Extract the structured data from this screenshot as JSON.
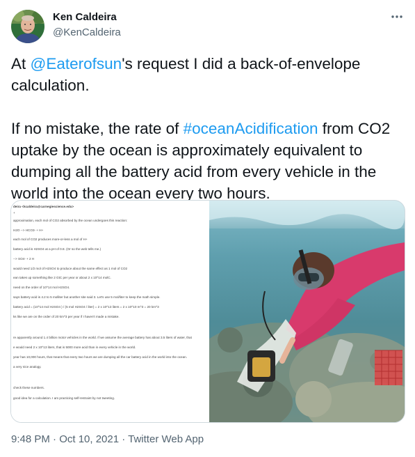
{
  "author": {
    "name": "Ken Caldeira",
    "handle": "@KenCaldeira"
  },
  "more_icon": "more-horizontal-icon",
  "tweet": {
    "p1_before": "At ",
    "p1_mention": "@Eaterofsun",
    "p1_after": "'s request I did a back-of-envelope calculation.",
    "p2_before": "If no mistake, the rate of ",
    "p2_hashtag": "#oceanAcidification",
    "p2_after": " from CO2 uptake by the ocean is approximately equivalent to dumping all the battery acid from every vehicle in the world into the ocean every two hours."
  },
  "media": {
    "document_lines": [
      "deira <kcaldeira@carnegiescience.edu>",
      "+",
      "approximation, each mol of CO2 absorbed by the ocean undergoes this reaction:",
      "H2O --> HCO3- + H+",
      "each mol of CO2 produces more-or-less a mol of H+",
      "battery acid is H2SO4 at a pH of 0.8. (Or so the web tells me.)",
      "--> SO4- + 2 H",
      "would need 1/2 mol of H2SO4 to produce about the same effect as 1 mol of CO2",
      "ean takes up something like 2 GtC per year or about 2 x 10^14 molC.",
      "need on the order of 10^14 mol H2SO4.",
      "says battery acid is 4.2 to 5 molliter but another site said 3. Let's use 5 mol/liter to keep the math simple.",
      "battery acid = (10^14 mol H2SO4 ) / (5 mol H2SO4 / liter) = 2 x 10^13 liters = 2 x 10^10 m^3 = 20 km^3",
      "ks like we are on the order of 20 km^3 per year if I haven't made a mistake.",
      "re apparently around 1.4 billion motor vehicles in the world. If we assume the average battery has about 3.5 liters of water, that",
      "e would need 2 x 10^13 liters, that is 5000 more acid than in every vehicle in the world.",
      "year has 10,000 hours, that means that every two hours we are dumping all the car battery acid in the world into the ocean.",
      "a very nice analogy.",
      "check these numbers.",
      "good idea for a calculation. I am practicing self-restraint by not tweeting."
    ]
  },
  "footer": {
    "timestamp": "9:48 PM · Oct 10, 2021 · Twitter Web App"
  }
}
